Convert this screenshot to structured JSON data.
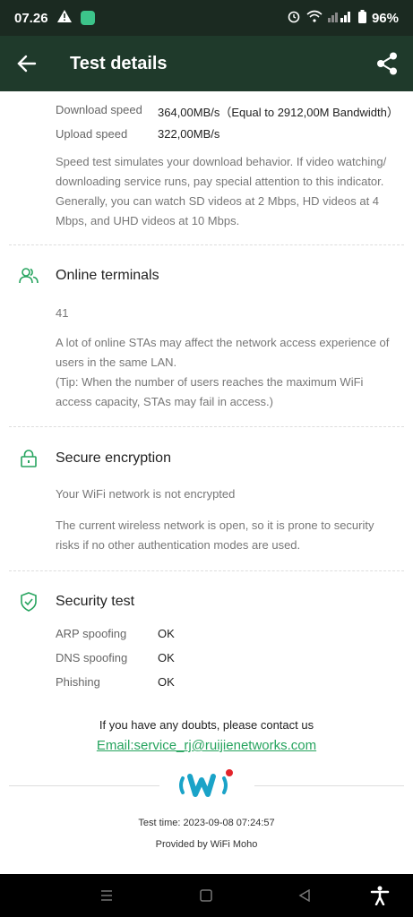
{
  "status_bar": {
    "time": "07.26",
    "battery": "96%"
  },
  "app_bar": {
    "title": "Test details"
  },
  "speed": {
    "download_label": "Download speed",
    "download_value": "364,00MB/s（Equal to 2912,00M Bandwidth）",
    "upload_label": "Upload speed",
    "upload_value": "322,00MB/s",
    "description": "Speed test simulates your download behavior. If video watching/ downloading service runs, pay special attention to this indicator. Generally, you can watch SD videos at 2 Mbps, HD videos at 4 Mbps, and UHD videos at 10 Mbps."
  },
  "online_terminals": {
    "title": "Online terminals",
    "count": "41",
    "description_line1": "A lot of online STAs may affect the network access experience of users in the same LAN.",
    "description_line2": "(Tip: When the number of users reaches the maximum WiFi access capacity, STAs may fail in access.)"
  },
  "secure_encryption": {
    "title": "Secure encryption",
    "status": "Your WiFi network is not encrypted",
    "description": "The current wireless network is open, so it is prone to security risks if no other authentication modes are used."
  },
  "security_test": {
    "title": "Security test",
    "rows": [
      {
        "label": "ARP spoofing",
        "value": "OK"
      },
      {
        "label": "DNS spoofing",
        "value": "OK"
      },
      {
        "label": "Phishing",
        "value": "OK"
      }
    ]
  },
  "contact": {
    "text": "If you have any doubts, please contact us",
    "email": "Email:service_rj@ruijienetworks.com"
  },
  "footer": {
    "test_time": "Test time: 2023-09-08 07:24:57",
    "provided_by": "Provided by WiFi Moho"
  },
  "colors": {
    "accent": "#27a45f",
    "app_bar": "#1f3a2b",
    "logo_blue": "#1aa3c8",
    "logo_red": "#e3242b"
  }
}
